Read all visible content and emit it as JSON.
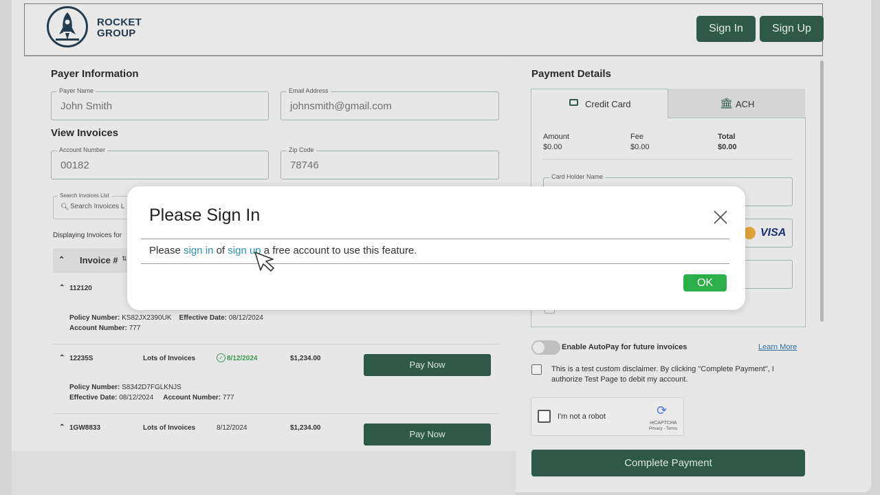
{
  "header": {
    "logo_line1": "ROCKET",
    "logo_line2": "GROUP",
    "signin_label": "Sign In",
    "signup_label": "Sign Up"
  },
  "payer": {
    "section_title": "Payer Information",
    "name_label": "Payer Name",
    "name_value": "John Smith",
    "email_label": "Email Address",
    "email_value": "johnsmith@gmail.com"
  },
  "invoices": {
    "section_title": "View Invoices",
    "account_label": "Account Number",
    "account_value": "00182",
    "zip_label": "Zip Code",
    "zip_value": "78746",
    "search_label": "Search Invoices List",
    "search_placeholder": "Search Invoices L",
    "displaying_text": "Displaying Invoices for",
    "column_header": "Invoice #",
    "rows": [
      {
        "number": "112120",
        "policy_label": "Policy Number:",
        "policy_value": "KS82JX2390UK",
        "effective_label": "Effective Date:",
        "effective_value": "08/12/2024",
        "account_label": "Account Number:",
        "account_value": "777"
      },
      {
        "number": "12235S",
        "description": "Lots of Invoices",
        "date": "8/12/2024",
        "amount": "$1,234.00",
        "pay_label": "Pay Now",
        "policy_label": "Policy Number:",
        "policy_value": "S8342D7FGLKNJS",
        "effective_label": "Effective Date:",
        "effective_value": "08/12/2024",
        "account_label": "Account Number:",
        "account_value": "777"
      },
      {
        "number": "1GW8833",
        "description": "Lots of Invoices",
        "date": "8/12/2024",
        "amount": "$1,234.00",
        "pay_label": "Pay Now"
      }
    ]
  },
  "payment": {
    "section_title": "Payment Details",
    "tab_card": "Credit Card",
    "tab_ach": "ACH",
    "amount_label": "Amount",
    "amount_value": "$0.00",
    "fee_label": "Fee",
    "fee_value": "$0.00",
    "total_label": "Total",
    "total_value": "$0.00",
    "card_holder_label": "Card Holder Name",
    "visa_text": "VISA",
    "autopay_label": "Enable AutoPay for future invoices",
    "learn_more": "Learn More",
    "disclaimer_line1": "This is a test custom disclaimer. By clicking \"Complete Payment\", I",
    "disclaimer_line2": "authorize Test Page to debit my account.",
    "captcha_label": "I'm not a robot",
    "captcha_brand": "reCAPTCHA",
    "captcha_links": "Privacy - Terms",
    "complete_label": "Complete Payment"
  },
  "modal": {
    "title": "Please Sign In",
    "body_prefix": "Please ",
    "link_signin": "sign in",
    "body_mid": " of ",
    "link_signup": "sign up",
    "body_suffix": " a free account to use this feature.",
    "ok_label": "OK"
  },
  "colors": {
    "brand_green": "#2e5847",
    "ok_green": "#2cae48",
    "link_blue": "#2a8fb8",
    "logo_navy": "#233b4f"
  }
}
